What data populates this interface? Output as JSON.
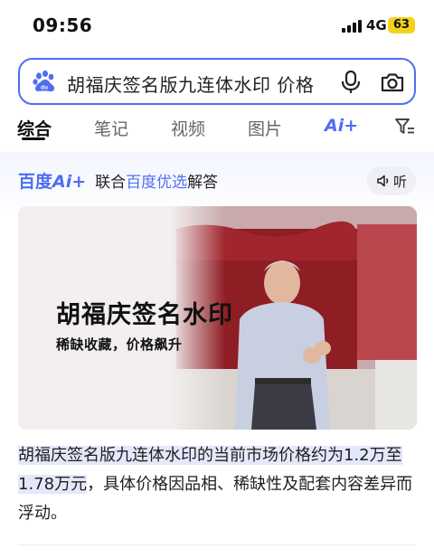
{
  "status_bar": {
    "time": "09:56",
    "network": "4G",
    "battery": "63",
    "battery_color": "#f5d21a"
  },
  "search": {
    "query": "胡福庆签名版九连体水印 价格",
    "accent_color": "#4e6ef2",
    "left_icon": "baidu-paw-icon",
    "mic_icon": "microphone-icon",
    "camera_icon": "camera-icon"
  },
  "tabs": [
    {
      "label": "综合",
      "active": true
    },
    {
      "label": "笔记",
      "active": false
    },
    {
      "label": "视频",
      "active": false
    },
    {
      "label": "图片",
      "active": false
    },
    {
      "label": "Ai+",
      "active": false
    }
  ],
  "filter_icon": "filter-icon",
  "ai_answer": {
    "brand_baidu": "百度",
    "brand_ai": "Ai+",
    "header_part1": "联合",
    "header_highlight": "百度优选",
    "header_part2": "解答",
    "listen_label": "听",
    "listen_icon": "speaker-icon",
    "image": {
      "title": "胡福庆签名水印",
      "subtitle": "稀缺收藏，价格飙升"
    },
    "answer_highlight": "胡福庆签名版九连体水印的当前市场价格约为1.2万至1.78万元",
    "answer_rest": "，具体价格因品相、稀缺性及配套内容差异而浮动。"
  }
}
